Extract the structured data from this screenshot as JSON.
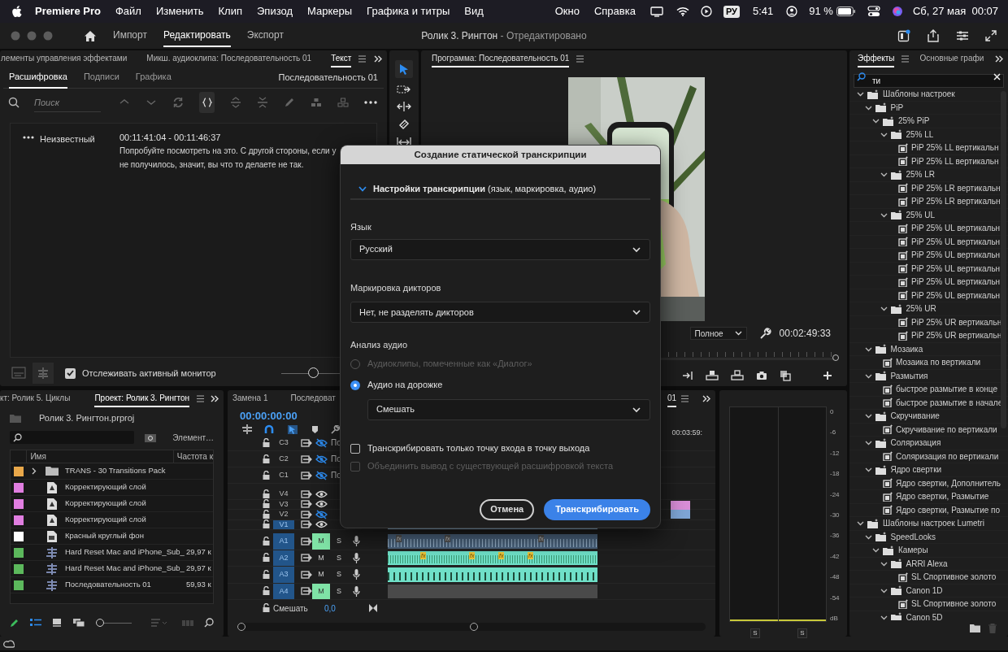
{
  "menu_bar": {
    "app": "Premiere Pro",
    "items": [
      "Файл",
      "Изменить",
      "Клип",
      "Эпизод",
      "Маркеры",
      "Графика и титры",
      "Вид"
    ],
    "right_items": [
      "Окно",
      "Справка"
    ],
    "input_source": "РУ",
    "clock": "5:41",
    "battery": "91 %",
    "datetime": "Сб, 27 мая  00:07"
  },
  "title_bar": {
    "workspaces": [
      {
        "label": "Импорт",
        "selected": false
      },
      {
        "label": "Редактировать",
        "selected": true
      },
      {
        "label": "Экспорт",
        "selected": false
      }
    ],
    "project": "Ролик 3. Рингтон",
    "status": " - Отредактировано"
  },
  "text_panel": {
    "tabs": [
      {
        "label": "лементы управления эффектами",
        "selected": false
      },
      {
        "label": "Микш. аудиоклипа: Последовательность 01",
        "selected": false
      },
      {
        "label": "Текст",
        "selected": true
      }
    ],
    "subtabs": [
      {
        "label": "Расшифровка",
        "selected": true
      },
      {
        "label": "Подписи",
        "selected": false
      },
      {
        "label": "Графика",
        "selected": false
      }
    ],
    "sequence": "Последовательность 01",
    "search": {
      "placeholder": "Поиск"
    },
    "entries": [
      {
        "speaker": "Неизвестный",
        "time": "00:11:41:04 - 00:11:46:37",
        "lines": [
          "Попробуйте посмотреть на это. С другой стороны, если у",
          "не получилось, значит, вы что то делаете не так."
        ]
      }
    ],
    "follow_monitor": {
      "label": "Отслеживать активный монитор",
      "checked": true
    },
    "zoom": {
      "level": 0.3
    }
  },
  "program": {
    "title": "Программа: Последовательность 01",
    "fit": "Полное",
    "timecode": "00:02:49:33"
  },
  "project": {
    "tabs": [
      {
        "label": "кт: Ролик 5. Циклы",
        "selected": false
      },
      {
        "label": "Проект: Ролик 3. Рингтон",
        "selected": true
      }
    ],
    "file": "Ролик 3. Рингтон.prproj",
    "items_label": "Элемент…",
    "thumbnail_size": {
      "level": 0
    },
    "columns": [
      "Имя",
      "Частота к"
    ],
    "rows": [
      {
        "color": "#e9a84a",
        "kind": "folder",
        "name": "TRANS - 30 Transitions Pack"
      },
      {
        "color": "#e07ee0",
        "kind": "adjustment",
        "name": "Корректирующий слой"
      },
      {
        "color": "#e07ee0",
        "kind": "adjustment",
        "name": "Корректирующий слой"
      },
      {
        "color": "#e07ee0",
        "kind": "adjustment",
        "name": "Корректирующий слой"
      },
      {
        "color": "#ffffff",
        "kind": "graphic",
        "name": "Красный круглый фон"
      },
      {
        "color": "#5cb85c",
        "kind": "sequence",
        "name": "Hard Reset Mac and iPhone_Sub_",
        "rate": "29,97 к"
      },
      {
        "color": "#5cb85c",
        "kind": "sequence",
        "name": "Hard Reset Mac and iPhone_Sub_",
        "rate": "29,97 к"
      },
      {
        "color": "#5cb85c",
        "kind": "sequence",
        "name": "Последовательность 01",
        "rate": "59,93 к"
      }
    ]
  },
  "timeline": {
    "tabs": [
      {
        "label": "Замена 1",
        "selected": false
      },
      {
        "label": "Последоват",
        "selected": false
      },
      {
        "label": "01",
        "selected": true
      }
    ],
    "timecode": "00:00:00:00",
    "ruler_time": "00:03:59:",
    "tracks": [
      {
        "name": "C3",
        "kind": "caption",
        "visible": false,
        "label": "По"
      },
      {
        "name": "C2",
        "kind": "caption",
        "visible": false,
        "label": "По"
      },
      {
        "name": "C1",
        "kind": "caption",
        "visible": false,
        "label": "По"
      },
      {
        "name": "V4",
        "kind": "video",
        "visible": true,
        "targeted": false
      },
      {
        "name": "V3",
        "kind": "video",
        "visible": true,
        "targeted": false
      },
      {
        "name": "V2",
        "kind": "video",
        "visible": false,
        "targeted": false
      },
      {
        "name": "V1",
        "kind": "video",
        "visible": true,
        "targeted": true
      },
      {
        "name": "A1",
        "kind": "audio",
        "targeted": true,
        "muted": true,
        "mute_label": "M",
        "solo_label": "S",
        "fx": [
          "fx",
          "fx",
          "fx"
        ]
      },
      {
        "name": "A2",
        "kind": "audio",
        "targeted": true,
        "muted": false,
        "mute_label": "M",
        "solo_label": "S",
        "fx": [
          "fx",
          "fx",
          "fx",
          "fx"
        ]
      },
      {
        "name": "A3",
        "kind": "audio",
        "targeted": true,
        "muted": false,
        "mute_label": "M",
        "solo_label": "S"
      },
      {
        "name": "A4",
        "kind": "audio",
        "targeted": true,
        "muted": true,
        "mute_label": "M",
        "solo_label": "S"
      }
    ],
    "mix": {
      "label": "Смешать",
      "value": "0,0"
    }
  },
  "meters": {
    "scale": [
      "0",
      "-6",
      "-12",
      "-18",
      "-24",
      "-30",
      "-36",
      "-42",
      "-48",
      "-54",
      "dB"
    ],
    "solo_buttons": [
      "S",
      "S"
    ]
  },
  "effects": {
    "tabs": [
      {
        "label": "Эффекты",
        "selected": true
      },
      {
        "label": "Основные графи",
        "selected": false
      }
    ],
    "search": {
      "value": "ти"
    },
    "tree": [
      {
        "label": "Шаблоны настроек",
        "kind": "bin",
        "expanded": true,
        "children": [
          {
            "label": "PiP",
            "kind": "bin",
            "expanded": true,
            "children": [
              {
                "label": "25% PiP",
                "kind": "bin",
                "expanded": true,
                "children": [
                  {
                    "label": "25% LL",
                    "kind": "bin",
                    "expanded": true,
                    "children": [
                      {
                        "label": "PiP 25% LL вертикальн",
                        "kind": "preset"
                      },
                      {
                        "label": "PiP 25% LL вертикальн",
                        "kind": "preset"
                      }
                    ]
                  },
                  {
                    "label": "25% LR",
                    "kind": "bin",
                    "expanded": true,
                    "children": [
                      {
                        "label": "PiP 25% LR вертикальн",
                        "kind": "preset"
                      },
                      {
                        "label": "PiP 25% LR вертикальн",
                        "kind": "preset"
                      }
                    ]
                  },
                  {
                    "label": "25% UL",
                    "kind": "bin",
                    "expanded": true,
                    "children": [
                      {
                        "label": "PiP 25% UL вертикальн",
                        "kind": "preset"
                      },
                      {
                        "label": "PiP 25% UL вертикальн",
                        "kind": "preset"
                      },
                      {
                        "label": "PiP 25% UL вертикальн",
                        "kind": "preset"
                      },
                      {
                        "label": "PiP 25% UL вертикальн",
                        "kind": "preset"
                      },
                      {
                        "label": "PiP 25% UL вертикальн",
                        "kind": "preset"
                      },
                      {
                        "label": "PiP 25% UL вертикальн",
                        "kind": "preset"
                      }
                    ]
                  },
                  {
                    "label": "25% UR",
                    "kind": "bin",
                    "expanded": true,
                    "children": [
                      {
                        "label": "PiP 25% UR вертикальн",
                        "kind": "preset"
                      },
                      {
                        "label": "PiP 25% UR вертикальн",
                        "kind": "preset"
                      }
                    ]
                  }
                ]
              }
            ]
          },
          {
            "label": "Мозаика",
            "kind": "bin",
            "expanded": true,
            "children": [
              {
                "label": "Мозаика по вертикали",
                "kind": "preset"
              }
            ]
          },
          {
            "label": "Размытия",
            "kind": "bin",
            "expanded": true,
            "children": [
              {
                "label": "быстрое размытие в конце",
                "kind": "preset"
              },
              {
                "label": "быстрое размытие в начале",
                "kind": "preset"
              }
            ]
          },
          {
            "label": "Скручивание",
            "kind": "bin",
            "expanded": true,
            "children": [
              {
                "label": "Скручивание по вертикали",
                "kind": "preset"
              }
            ]
          },
          {
            "label": "Соляризация",
            "kind": "bin",
            "expanded": true,
            "children": [
              {
                "label": "Соляризация по вертикали",
                "kind": "preset"
              }
            ]
          },
          {
            "label": "Ядро свертки",
            "kind": "bin",
            "expanded": true,
            "children": [
              {
                "label": "Ядро свертки, Дополнитель",
                "kind": "preset"
              },
              {
                "label": "Ядро свертки, Размытие",
                "kind": "preset"
              },
              {
                "label": "Ядро свертки, Размытие по",
                "kind": "preset"
              }
            ]
          }
        ]
      },
      {
        "label": "Шаблоны настроек Lumetri",
        "kind": "bin",
        "expanded": true,
        "children": [
          {
            "label": "SpeedLooks",
            "kind": "bin",
            "expanded": true,
            "children": [
              {
                "label": "Камеры",
                "kind": "bin",
                "expanded": true,
                "children": [
                  {
                    "label": "ARRI Alexa",
                    "kind": "bin",
                    "expanded": true,
                    "children": [
                      {
                        "label": "SL Спортивное золото",
                        "kind": "preset"
                      }
                    ]
                  },
                  {
                    "label": "Canon 1D",
                    "kind": "bin",
                    "expanded": true,
                    "children": [
                      {
                        "label": "SL Спортивное золото",
                        "kind": "preset"
                      }
                    ]
                  },
                  {
                    "label": "Canon 5D",
                    "kind": "bin",
                    "expanded": true
                  }
                ]
              }
            ]
          }
        ]
      }
    ]
  },
  "dialog": {
    "title": "Создание статической транскрипции",
    "section": {
      "label": "**Настройки транскрипции** (язык, маркировка, аудио)",
      "expanded": true
    },
    "language": {
      "label": "Язык",
      "value": "Русский"
    },
    "speakers": {
      "label": "Маркировка дикторов",
      "value": "Нет, не разделять дикторов"
    },
    "audio": {
      "label": "Анализ аудио",
      "options": [
        {
          "label": "Аудиоклипы, помеченные как «Диалог»",
          "selected": false,
          "disabled": true
        },
        {
          "label": "Аудио на дорожке",
          "selected": true,
          "disabled": false
        }
      ],
      "track": "Смешать"
    },
    "checkboxes": [
      {
        "label": "Транскрибировать только точку входа в точку выхода",
        "checked": false,
        "disabled": false
      },
      {
        "label": "Объединить вывод с существующей расшифровкой текста",
        "checked": false,
        "disabled": true
      }
    ],
    "buttons": [
      {
        "label": "Отмена",
        "kind": "secondary"
      },
      {
        "label": "Транскрибировать",
        "kind": "primary"
      }
    ]
  }
}
